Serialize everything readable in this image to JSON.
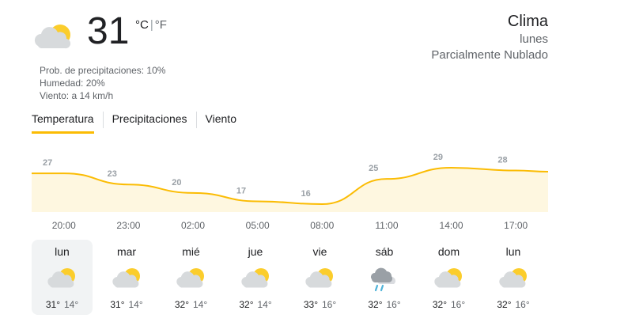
{
  "current": {
    "temp": "31",
    "unit_c": "°C",
    "unit_f": "°F",
    "icon": "partly-cloudy-icon",
    "precip": "Prob. de precipitaciones: 10%",
    "humidity": "Humedad: 20%",
    "wind": "Viento: a 14 km/h"
  },
  "header": {
    "title": "Clima",
    "day": "lunes",
    "condition": "Parcialmente Nublado"
  },
  "tabs": [
    {
      "label": "Temperatura",
      "active": true
    },
    {
      "label": "Precipitaciones",
      "active": false
    },
    {
      "label": "Viento",
      "active": false
    }
  ],
  "chart_data": {
    "type": "area",
    "labels": [
      "27",
      "23",
      "20",
      "17",
      "16",
      "25",
      "29",
      "28"
    ],
    "x": [
      "20:00",
      "23:00",
      "02:00",
      "05:00",
      "08:00",
      "11:00",
      "14:00",
      "17:00"
    ],
    "values": [
      27,
      23,
      20,
      17,
      16,
      25,
      29,
      28
    ],
    "colors": {
      "line": "#fbbc04",
      "fill": "#fef7e0"
    }
  },
  "days": [
    {
      "name": "lun",
      "hi": "31°",
      "lo": "14°",
      "icon": "partly-cloudy-icon",
      "active": true
    },
    {
      "name": "mar",
      "hi": "31°",
      "lo": "14°",
      "icon": "partly-cloudy-icon",
      "active": false
    },
    {
      "name": "mié",
      "hi": "32°",
      "lo": "14°",
      "icon": "partly-cloudy-icon",
      "active": false
    },
    {
      "name": "jue",
      "hi": "32°",
      "lo": "14°",
      "icon": "partly-cloudy-icon",
      "active": false
    },
    {
      "name": "vie",
      "hi": "33°",
      "lo": "16°",
      "icon": "partly-cloudy-icon",
      "active": false
    },
    {
      "name": "sáb",
      "hi": "32°",
      "lo": "16°",
      "icon": "rain-icon",
      "active": false
    },
    {
      "name": "dom",
      "hi": "32°",
      "lo": "16°",
      "icon": "partly-cloudy-icon",
      "active": false
    },
    {
      "name": "lun",
      "hi": "32°",
      "lo": "16°",
      "icon": "partly-cloudy-icon",
      "active": false
    }
  ]
}
